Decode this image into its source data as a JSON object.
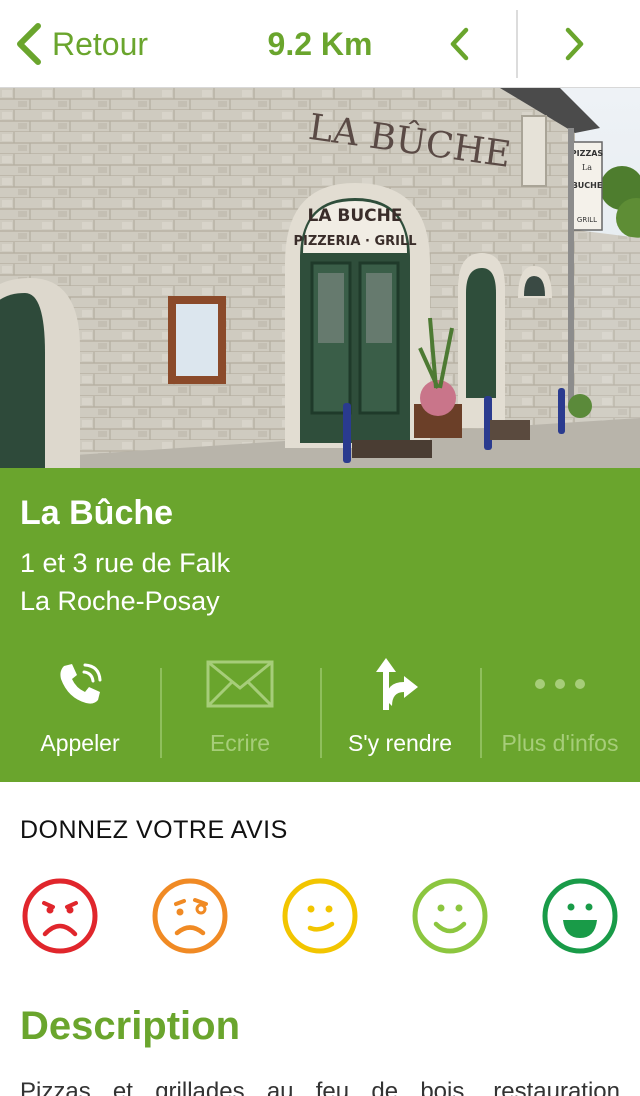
{
  "header": {
    "back_label": "Retour",
    "distance": "9.2 Km",
    "back_icon": "chevron-left-icon",
    "prev_icon": "chevron-left-icon",
    "next_icon": "chevron-right-icon",
    "accent_color": "#6aa52d"
  },
  "place": {
    "name": "La Bûche",
    "address_line1": "1 et 3 rue de Falk",
    "address_line2": "La Roche-Posay",
    "photo_signs": {
      "facade_letters": "LA BÛCHE",
      "arch_line1": "LA BUCHE",
      "arch_line2": "PIZZERIA · GRILL",
      "side_sign_1": "PIZZAS",
      "side_sign_2": "La",
      "side_sign_3": "BUCHE",
      "side_sign_4": "GRILL"
    }
  },
  "actions": [
    {
      "label": "Appeler",
      "icon": "phone-icon",
      "enabled": true
    },
    {
      "label": "Ecrire",
      "icon": "envelope-icon",
      "enabled": false
    },
    {
      "label": "S'y rendre",
      "icon": "directions-icon",
      "enabled": true
    },
    {
      "label": "Plus d'infos",
      "icon": "more-dots-icon",
      "enabled": false
    }
  ],
  "review": {
    "title": "DONNEZ VOTRE AVIS",
    "options": [
      {
        "icon": "very-sad-face-icon",
        "color": "#e0262c"
      },
      {
        "icon": "sad-face-icon",
        "color": "#f08a24"
      },
      {
        "icon": "neutral-face-icon",
        "color": "#f2c500"
      },
      {
        "icon": "happy-face-icon",
        "color": "#8cc63f"
      },
      {
        "icon": "very-happy-face-icon",
        "color": "#199b48"
      }
    ]
  },
  "description": {
    "title": "Description",
    "text": "Pizzas et grillades au feu de bois, restauration"
  }
}
